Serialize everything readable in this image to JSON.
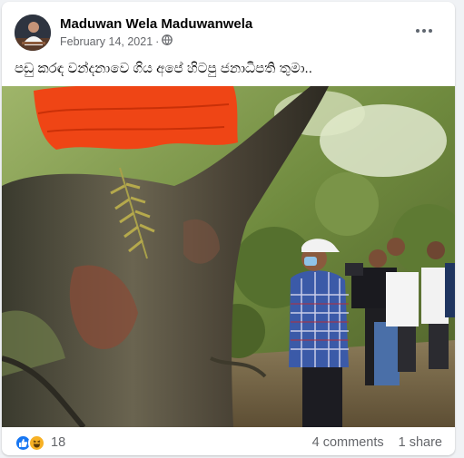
{
  "post": {
    "author": "Maduwan Wela Maduwanwela",
    "date": "February 14, 2021",
    "separator": "·",
    "privacy_icon": "globe-icon",
    "caption": "පඩු කරඳ වන්දනාවෙ ගිය අපේ හිටපු ජනාධිපති තුමා.."
  },
  "stats": {
    "reaction_icons": [
      "like-icon",
      "haha-icon"
    ],
    "reaction_count": "18",
    "comments": "4 comments",
    "shares": "1 share"
  },
  "colors": {
    "like": "#1877f2",
    "haha": "#f7b125",
    "cloth": "#ef4515"
  }
}
